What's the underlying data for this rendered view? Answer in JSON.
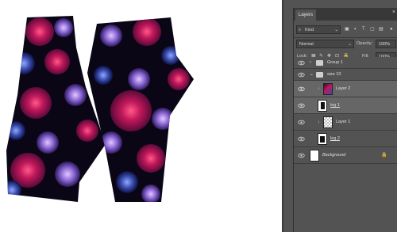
{
  "panel": {
    "tab_label": "Layers",
    "close_glyph": "×",
    "menu_glyph": "≡",
    "filter": {
      "kind_label": "Kind",
      "icon": "search-icon"
    },
    "blend_mode": "Normal",
    "opacity_label": "Opacity:",
    "opacity_value": "100%",
    "lock_label": "Lock:",
    "fill_label": "Fill:",
    "fill_value": "100%",
    "layers": [
      {
        "name": "Group 1",
        "kind": "group",
        "expanded": false,
        "selected": false
      },
      {
        "name": "size 10",
        "kind": "group",
        "expanded": true,
        "selected": false
      },
      {
        "name": "Layer 2",
        "kind": "pixel",
        "clipped": true,
        "selected": true
      },
      {
        "name": "leg 1",
        "kind": "pixel",
        "clipped": false,
        "selected": true
      },
      {
        "name": "Layer 1",
        "kind": "pixel",
        "clipped": true,
        "selected": false
      },
      {
        "name": "leg 2",
        "kind": "pixel",
        "clipped": false,
        "selected": false
      },
      {
        "name": "Background",
        "kind": "background",
        "locked": true,
        "selected": false
      }
    ]
  },
  "colors": {
    "panel_bg": "#535353",
    "selected_row": "#666666",
    "canvas_bg": "#ffffff",
    "print_dark": "#0a0616",
    "print_rose": "#c2185b",
    "print_violet": "#7e57c2",
    "print_blue": "#3949ab"
  }
}
